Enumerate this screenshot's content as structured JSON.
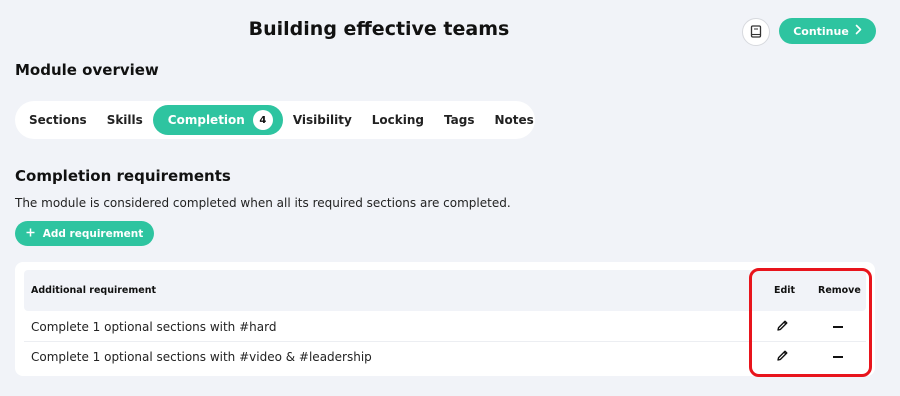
{
  "header": {
    "title": "Building effective teams",
    "continue_label": "Continue"
  },
  "overview": {
    "heading": "Module overview"
  },
  "tabs": [
    {
      "label": "Sections"
    },
    {
      "label": "Skills"
    },
    {
      "label": "Completion",
      "count": "4",
      "active": true
    },
    {
      "label": "Visibility"
    },
    {
      "label": "Locking"
    },
    {
      "label": "Tags"
    },
    {
      "label": "Notes"
    }
  ],
  "completion": {
    "heading": "Completion requirements",
    "description": "The module is considered completed when all its required sections are completed.",
    "add_label": "Add requirement"
  },
  "table": {
    "columns": [
      "Additional requirement",
      "Edit",
      "Remove"
    ],
    "rows": [
      {
        "requirement": "Complete 1 optional sections with #hard"
      },
      {
        "requirement": "Complete 1 optional sections with #video & #leadership"
      }
    ]
  },
  "colors": {
    "accent": "#2ec4a0",
    "background": "#f1f3f8",
    "highlight": "#e8141c"
  },
  "icons": [
    "book-icon",
    "chevron-right-icon",
    "plus-icon",
    "pencil-icon",
    "minus-icon"
  ]
}
